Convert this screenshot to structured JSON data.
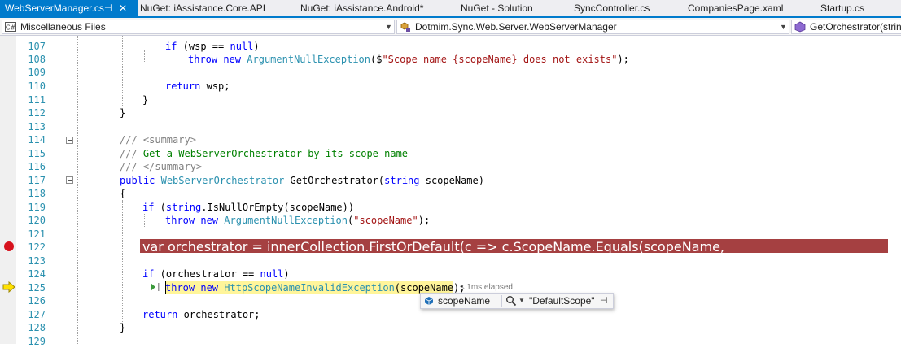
{
  "tabs": [
    {
      "label": "WebServerManager.cs",
      "active": true
    },
    {
      "label": "NuGet: iAssistance.Core.API",
      "active": false
    },
    {
      "label": "NuGet: iAssistance.Android*",
      "active": false
    },
    {
      "label": "NuGet - Solution",
      "active": false
    },
    {
      "label": "SyncController.cs",
      "active": false
    },
    {
      "label": "CompaniesPage.xaml",
      "active": false
    },
    {
      "label": "Startup.cs",
      "active": false
    }
  ],
  "tab_pin_glyph": "⊣",
  "tab_close_glyph": "✕",
  "nav": {
    "project": "Miscellaneous Files",
    "type": "Dotmim.Sync.Web.Server.WebServerManager",
    "member": "GetOrchestrator(string"
  },
  "lines": [
    {
      "n": "107"
    },
    {
      "n": "108"
    },
    {
      "n": "109"
    },
    {
      "n": "110"
    },
    {
      "n": "111"
    },
    {
      "n": "112"
    },
    {
      "n": "113"
    },
    {
      "n": "114"
    },
    {
      "n": "115"
    },
    {
      "n": "116"
    },
    {
      "n": "117"
    },
    {
      "n": "118"
    },
    {
      "n": "119"
    },
    {
      "n": "120"
    },
    {
      "n": "121"
    },
    {
      "n": "122"
    },
    {
      "n": "123"
    },
    {
      "n": "124"
    },
    {
      "n": "125"
    },
    {
      "n": "126"
    },
    {
      "n": "127"
    },
    {
      "n": "128"
    },
    {
      "n": "129"
    }
  ],
  "code": {
    "l107": [
      "if",
      " (wsp == ",
      "null",
      ")"
    ],
    "l108": [
      "throw",
      " ",
      "new",
      " ",
      "ArgumentNullException",
      "($",
      "\"Scope name {scopeName} does not exists\"",
      ");"
    ],
    "l110": [
      "return",
      " wsp;"
    ],
    "l111": "}",
    "l112": "}",
    "l114": [
      "///",
      " <summary>"
    ],
    "l115": [
      "///",
      " Get a WebServerOrchestrator by its scope name"
    ],
    "l116": [
      "///",
      " </summary>"
    ],
    "l117": [
      "public",
      " ",
      "WebServerOrchestrator",
      " GetOrchestrator(",
      "string",
      " scopeName)"
    ],
    "l118": "{",
    "l119": [
      "if",
      " (",
      "string",
      ".IsNullOrEmpty(scopeName))"
    ],
    "l120": [
      "throw",
      " ",
      "new",
      " ",
      "ArgumentNullException",
      "(",
      "\"scopeName\"",
      ");"
    ],
    "l122": "var orchestrator = innerCollection.FirstOrDefault(c => c.ScopeName.Equals(scopeName, SyncGlobalization.DataSourceStringComparison));",
    "l124": [
      "if",
      " (orchestrator == ",
      "null",
      ")"
    ],
    "l125": [
      "throw",
      " ",
      "new",
      " ",
      "HttpScopeNameInvalidException",
      "(scopeName);"
    ],
    "l127": [
      "return",
      " orchestrator;"
    ],
    "l128": "}"
  },
  "perf_tip": "≤ 1ms elapsed",
  "datatip": {
    "name": "scopeName",
    "value": "\"DefaultScope\"",
    "pin_glyph": "⊣"
  },
  "colors": {
    "accent": "#007acc",
    "keyword": "#0000ff",
    "type": "#2b91af",
    "string": "#a31515",
    "comment": "#008000",
    "breakpoint_line": "#a54041",
    "current_line": "#fff59a"
  }
}
